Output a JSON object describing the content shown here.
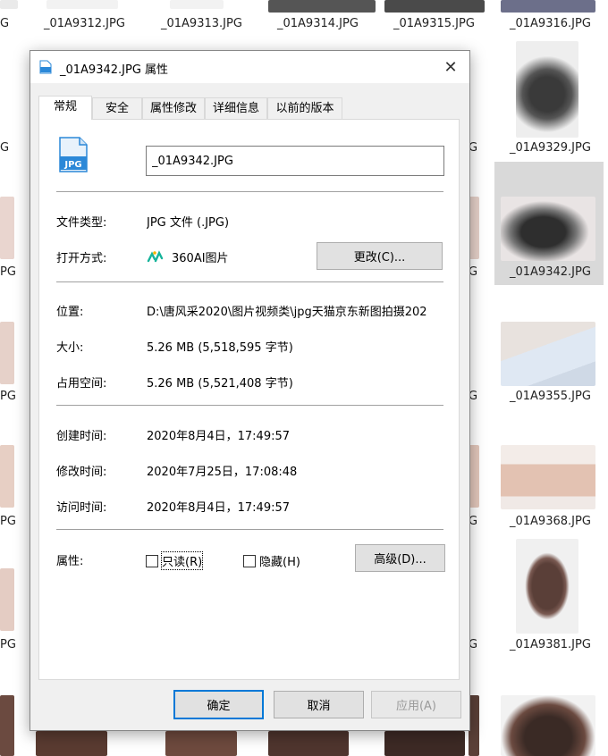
{
  "background": {
    "filenames": {
      "r0": [
        "_01A9312.JPG",
        "_01A9313.JPG",
        "_01A9314.JPG",
        "_01A9315.JPG",
        "_01A9316.JPG"
      ],
      "r0_left_fragment": "G",
      "right_col": [
        "_01A9329.JPG",
        "_01A9342.JPG",
        "_01A9355.JPG",
        "_01A9368.JPG",
        "_01A9381.JPG"
      ],
      "left_fragment": "PG",
      "mid_fragment": "G"
    }
  },
  "dialog": {
    "title": "_01A9342.JPG 属性",
    "close_glyph": "✕",
    "tabs": [
      "常规",
      "安全",
      "属性修改",
      "详细信息",
      "以前的版本"
    ],
    "file_name": "_01A9342.JPG",
    "file_icon_text": "JPG",
    "rows": {
      "type_label": "文件类型:",
      "type_value": "JPG 文件 (.JPG)",
      "open_label": "打开方式:",
      "open_value": "360AI图片",
      "change_button": "更改(C)...",
      "location_label": "位置:",
      "location_value": "D:\\唐风采2020\\图片视频类\\jpg天猫京东新图拍摄202",
      "size_label": "大小:",
      "size_value": "5.26 MB (5,518,595 字节)",
      "disk_label": "占用空间:",
      "disk_value": "5.26 MB (5,521,408 字节)",
      "created_label": "创建时间:",
      "created_value": "2020年8月4日，17:49:57",
      "modified_label": "修改时间:",
      "modified_value": "2020年7月25日，17:08:48",
      "accessed_label": "访问时间:",
      "accessed_value": "2020年8月4日，17:49:57",
      "attr_label": "属性:",
      "readonly_label": "只读(R)",
      "hidden_label": "隐藏(H)",
      "advanced_button": "高级(D)..."
    },
    "buttons": {
      "ok": "确定",
      "cancel": "取消",
      "apply": "应用(A)"
    }
  },
  "colors": {
    "accent": "#0078d7",
    "icon_blue": "#2b88d8"
  }
}
